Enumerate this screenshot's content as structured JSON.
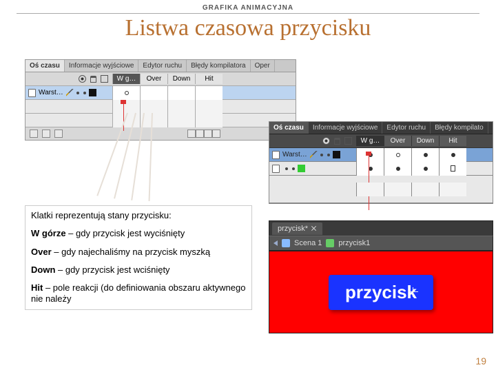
{
  "header": {
    "label": "GRAFIKA ANIMACYJNA"
  },
  "title": "Listwa czasowa przycisku",
  "timeline": {
    "tabs": [
      "Oś czasu",
      "Informacje wyjściowe",
      "Edytor ruchu",
      "Błędy kompilatora",
      "Oper"
    ],
    "tabs_b": [
      "Oś czasu",
      "Informacje wyjściowe",
      "Edytor ruchu",
      "Błędy kompilato"
    ],
    "frame_labels": [
      "W g…",
      "Over",
      "Down",
      "Hit"
    ],
    "layer_a": "Warst…",
    "layer_b1": "Warst…",
    "layer_b2": ""
  },
  "stage": {
    "tab": "przycisk*",
    "crumb_scene": "Scena 1",
    "crumb_clip": "przycisk1",
    "button_text": "przycisk"
  },
  "text": {
    "intro": "Klatki reprezentują stany przycisku:",
    "up_b": "W górze",
    "up_r": " – gdy przycisk jest wyciśnięty",
    "over_b": "Over",
    "over_r": " – gdy najechaliśmy na przycisk myszką",
    "down_b": "Down",
    "down_r": " – gdy przycisk jest wciśnięty",
    "hit_b": "Hit",
    "hit_r": " – pole reakcji (do definiowania obszaru aktywnego nie należy"
  },
  "pagenum": "19"
}
